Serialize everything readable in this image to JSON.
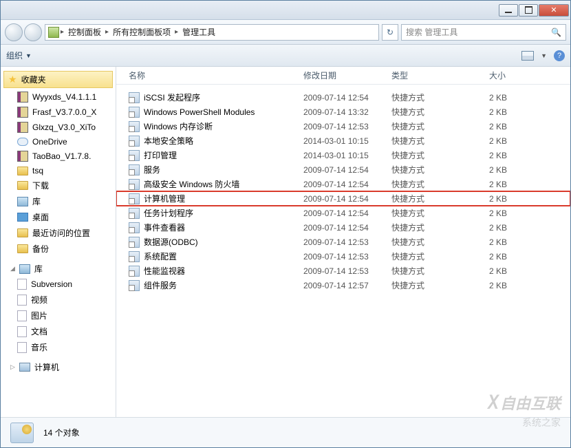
{
  "titlebar": {},
  "nav": {
    "breadcrumb": [
      "控制面板",
      "所有控制面板项",
      "管理工具"
    ],
    "search_placeholder": "搜索 管理工具"
  },
  "toolbar": {
    "organize_label": "组织"
  },
  "sidebar": {
    "favorites_label": "收藏夹",
    "items": [
      {
        "label": "Wyyxds_V4.1.1.1",
        "icon": "rar"
      },
      {
        "label": "Frasf_V3.7.0.0_X",
        "icon": "rar"
      },
      {
        "label": "Glxzq_V3.0_XiTo",
        "icon": "rar"
      },
      {
        "label": "OneDrive",
        "icon": "cloud"
      },
      {
        "label": "TaoBao_V1.7.8.",
        "icon": "rar"
      },
      {
        "label": "tsq",
        "icon": "folder"
      },
      {
        "label": "下载",
        "icon": "folder"
      },
      {
        "label": "库",
        "icon": "lib"
      },
      {
        "label": "桌面",
        "icon": "desktop"
      },
      {
        "label": "最近访问的位置",
        "icon": "folder"
      },
      {
        "label": "备份",
        "icon": "folder"
      }
    ],
    "libraries_label": "库",
    "libraries": [
      {
        "label": "Subversion"
      },
      {
        "label": "视频"
      },
      {
        "label": "图片"
      },
      {
        "label": "文档"
      },
      {
        "label": "音乐"
      }
    ],
    "computer_label": "计算机"
  },
  "columns": {
    "name": "名称",
    "date": "修改日期",
    "type": "类型",
    "size": "大小"
  },
  "files": [
    {
      "name": "iSCSI 发起程序",
      "date": "2009-07-14 12:54",
      "type": "快捷方式",
      "size": "2 KB",
      "highlighted": false
    },
    {
      "name": "Windows PowerShell Modules",
      "date": "2009-07-14 13:32",
      "type": "快捷方式",
      "size": "2 KB",
      "highlighted": false
    },
    {
      "name": "Windows 内存诊断",
      "date": "2009-07-14 12:53",
      "type": "快捷方式",
      "size": "2 KB",
      "highlighted": false
    },
    {
      "name": "本地安全策略",
      "date": "2014-03-01 10:15",
      "type": "快捷方式",
      "size": "2 KB",
      "highlighted": false
    },
    {
      "name": "打印管理",
      "date": "2014-03-01 10:15",
      "type": "快捷方式",
      "size": "2 KB",
      "highlighted": false
    },
    {
      "name": "服务",
      "date": "2009-07-14 12:54",
      "type": "快捷方式",
      "size": "2 KB",
      "highlighted": false
    },
    {
      "name": "高级安全 Windows 防火墙",
      "date": "2009-07-14 12:54",
      "type": "快捷方式",
      "size": "2 KB",
      "highlighted": false
    },
    {
      "name": "计算机管理",
      "date": "2009-07-14 12:54",
      "type": "快捷方式",
      "size": "2 KB",
      "highlighted": true
    },
    {
      "name": "任务计划程序",
      "date": "2009-07-14 12:54",
      "type": "快捷方式",
      "size": "2 KB",
      "highlighted": false
    },
    {
      "name": "事件查看器",
      "date": "2009-07-14 12:54",
      "type": "快捷方式",
      "size": "2 KB",
      "highlighted": false
    },
    {
      "name": "数据源(ODBC)",
      "date": "2009-07-14 12:53",
      "type": "快捷方式",
      "size": "2 KB",
      "highlighted": false
    },
    {
      "name": "系统配置",
      "date": "2009-07-14 12:53",
      "type": "快捷方式",
      "size": "2 KB",
      "highlighted": false
    },
    {
      "name": "性能监视器",
      "date": "2009-07-14 12:53",
      "type": "快捷方式",
      "size": "2 KB",
      "highlighted": false
    },
    {
      "name": "组件服务",
      "date": "2009-07-14 12:57",
      "type": "快捷方式",
      "size": "2 KB",
      "highlighted": false
    }
  ],
  "status": {
    "count_label": "14 个对象"
  },
  "watermark": {
    "line1": "自由互联",
    "line2": "系统之家"
  }
}
